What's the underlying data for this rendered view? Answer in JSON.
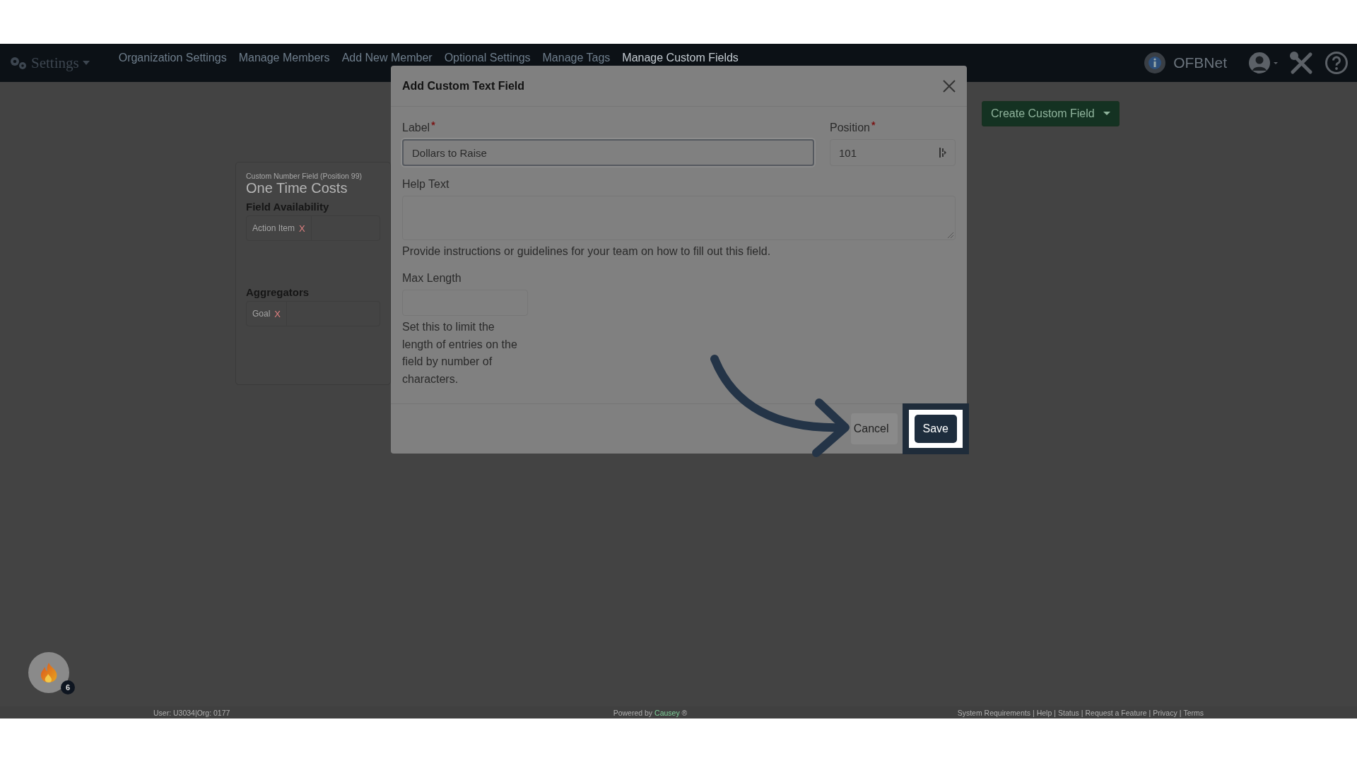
{
  "nav": {
    "title": "Settings",
    "links": [
      {
        "label": "Organization Settings",
        "selected": false
      },
      {
        "label": "Manage Members",
        "selected": false
      },
      {
        "label": "Add New Member",
        "selected": false
      },
      {
        "label": "Optional Settings",
        "selected": false
      },
      {
        "label": "Manage Tags",
        "selected": false
      },
      {
        "label": "Manage Custom Fields",
        "selected": true
      }
    ],
    "org_name": "OFBNet"
  },
  "create_button": "Create Custom Field",
  "card": {
    "subtitle": "Custom Number Field (Position 99)",
    "title": "One Time Costs",
    "sections": [
      {
        "heading": "Field Availability",
        "tags": [
          {
            "label": "Action Item",
            "remove": "X"
          }
        ]
      },
      {
        "heading": "Aggregators",
        "tags": [
          {
            "label": "Goal",
            "remove": "X"
          }
        ]
      }
    ]
  },
  "modal": {
    "title": "Add Custom Text Field",
    "fields": [
      {
        "kind": "text",
        "label": "Label",
        "required_mark": "*",
        "value": "Dollars to Raise",
        "focused": true
      },
      {
        "kind": "number",
        "label": "Position",
        "required_mark": "*",
        "value": "101",
        "focused": false
      }
    ],
    "help_text": {
      "label": "Help Text",
      "hint": "Provide instructions or guidelines for your team on how to fill out this field."
    },
    "max_length": {
      "label": "Max Length",
      "hint": "Set this to limit the length of entries on the field by number of characters."
    },
    "buttons": [
      {
        "kind": "secondary",
        "label": "Cancel",
        "highlighted": false
      },
      {
        "kind": "primary",
        "label": "Save",
        "highlighted": true
      }
    ]
  },
  "notification": {
    "count": "6"
  },
  "footer": {
    "user": "User: U3034|Org: 0177",
    "powered_by": {
      "text": "Powered by",
      "link": "Causey",
      "suffix": "®"
    },
    "separator": "|",
    "links": [
      "System Requirements",
      "Help",
      "Status",
      "Request a Feature",
      "Privacy",
      "Terms"
    ]
  }
}
